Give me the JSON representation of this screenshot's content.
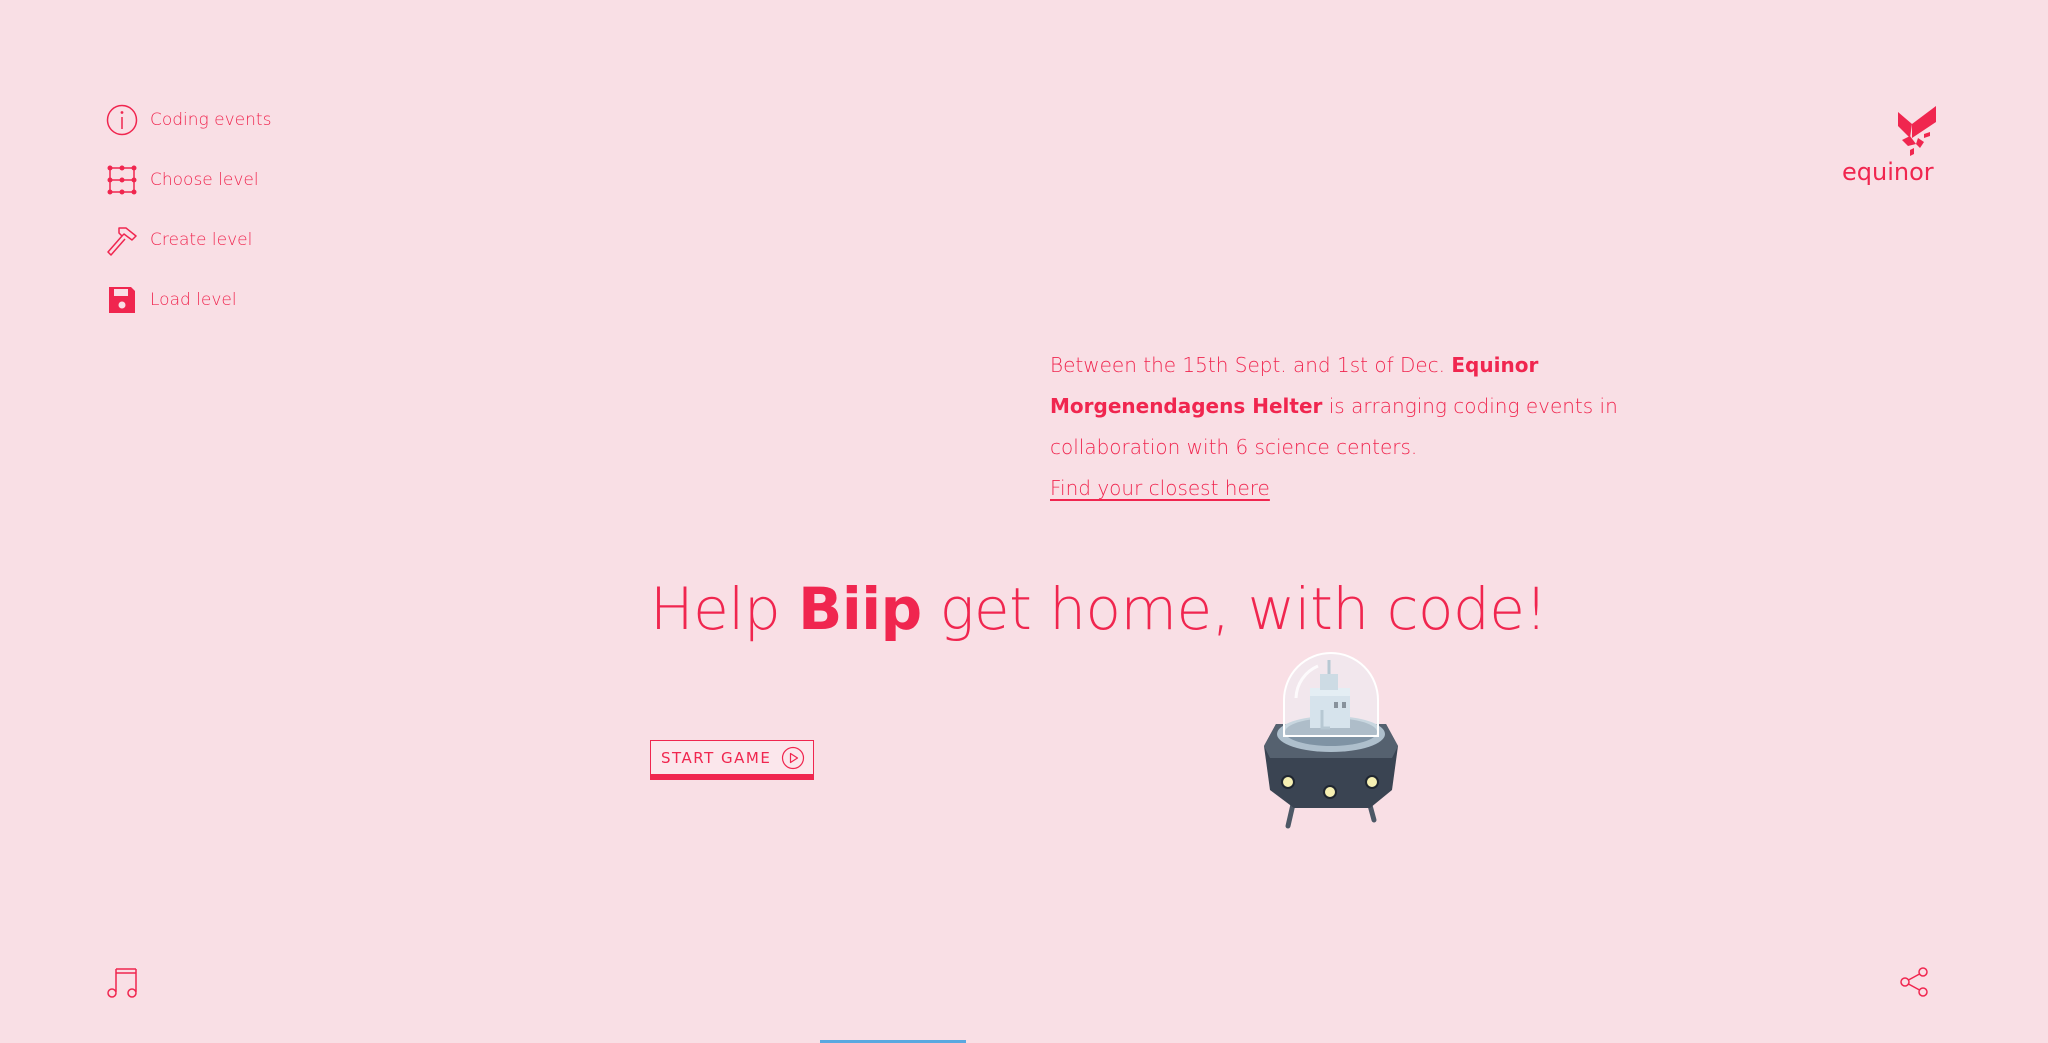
{
  "nav": {
    "items": [
      {
        "label": "Coding events",
        "icon": "info-icon"
      },
      {
        "label": "Choose level",
        "icon": "grid-icon"
      },
      {
        "label": "Create level",
        "icon": "hammer-icon"
      },
      {
        "label": "Load level",
        "icon": "save-icon"
      }
    ]
  },
  "logo": {
    "text": "equinor"
  },
  "info": {
    "text_before": "Between the 15th Sept. and 1st of Dec. ",
    "bold_org": "Equinor Morgenendagens Helter",
    "text_after": " is arranging coding events in collaboration with 6 science centers.",
    "link_label": "Find your closest here"
  },
  "hero": {
    "title_part1": "Help ",
    "title_bold": "Biip",
    "title_part2": " get home, with code!",
    "start_label": "START GAME"
  },
  "colors": {
    "background": "#f9dfe5",
    "accent": "#f0264f",
    "robot_dark": "#3a4452",
    "robot_light": "#b9cfdc"
  }
}
